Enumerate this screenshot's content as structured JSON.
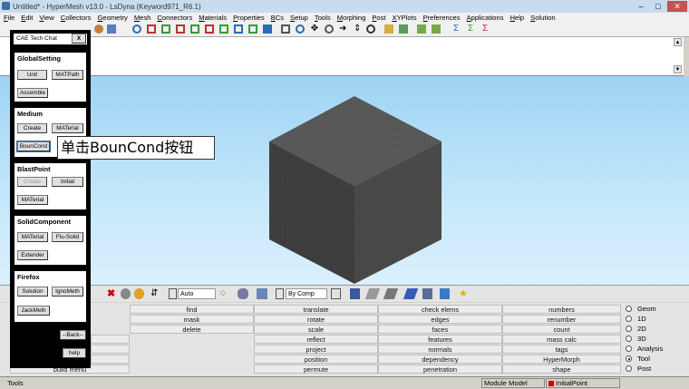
{
  "window": {
    "title": "Untitled* - HyperMesh v13.0 - LsDyna (Keyword971_R6.1)",
    "minimize": "–",
    "maximize": "□",
    "close": "✕"
  },
  "menu": [
    "File",
    "Edit",
    "View",
    "Collectors",
    "Geometry",
    "Mesh",
    "Connectors",
    "Materials",
    "Properties",
    "BCs",
    "Setup",
    "Tools",
    "Morphing",
    "Post",
    "XYPlots",
    "Preferences",
    "Applications",
    "Help",
    "Solution"
  ],
  "colors": {
    "viewport_top": "#9fd3f3",
    "cube_top": "#5c5c5c",
    "cube_left": "#404040",
    "cube_right": "#4c4c4c",
    "mesh_line": "#2a2a2a",
    "status_red": "#cc0000"
  },
  "bottom_toolbar": {
    "auto_select": "Auto",
    "by_comp_select": "By Comp"
  },
  "panels": {
    "col1": [
      "find",
      "mask",
      "delete",
      "",
      "",
      "",
      ""
    ],
    "col2": [
      "translate",
      "rotate",
      "scale",
      "reflect",
      "project",
      "position",
      "permute"
    ],
    "col3": [
      "check elems",
      "edges",
      "faces",
      "features",
      "normals",
      "dependency",
      "penetration"
    ],
    "col4": [
      "numbers",
      "renumber",
      "count",
      "mass calc",
      "tags",
      "HyperMorph",
      "shape"
    ],
    "col0_bottom": "build menu"
  },
  "radios": [
    {
      "label": "Geom",
      "selected": false
    },
    {
      "label": "1D",
      "selected": false
    },
    {
      "label": "2D",
      "selected": false
    },
    {
      "label": "3D",
      "selected": false
    },
    {
      "label": "Analysis",
      "selected": false
    },
    {
      "label": "Tool",
      "selected": true
    },
    {
      "label": "Post",
      "selected": false
    }
  ],
  "status": {
    "left": "Tools",
    "module": "Module Model",
    "initial": "InitialPoint"
  },
  "tech_chat": {
    "title": "CAE Tech Chat",
    "close": "X",
    "global_title": "GlobalSetting",
    "unit": "Unit",
    "matpath": "MATPath",
    "assemble": "Assemble",
    "medium_title": "Medium",
    "medium_create": "Create",
    "medium_material": "MATerial",
    "bouncond": "BounCond",
    "blast_title": "BlastPoint",
    "blast_create": "Create",
    "blast_initial": "Initial",
    "blast_material": "MATerial",
    "solid_title": "SolidComponent",
    "solid_material": "MATerial",
    "flu_solid": "Flu-Solid",
    "extender": "Extender",
    "firefox_title": "Firefox",
    "solution": "Solution",
    "ignometh": "IgnoMeth",
    "jackmeth": "JackMeth",
    "back": "--Back--",
    "help": "help"
  },
  "callout": "单击BounCond按钮"
}
